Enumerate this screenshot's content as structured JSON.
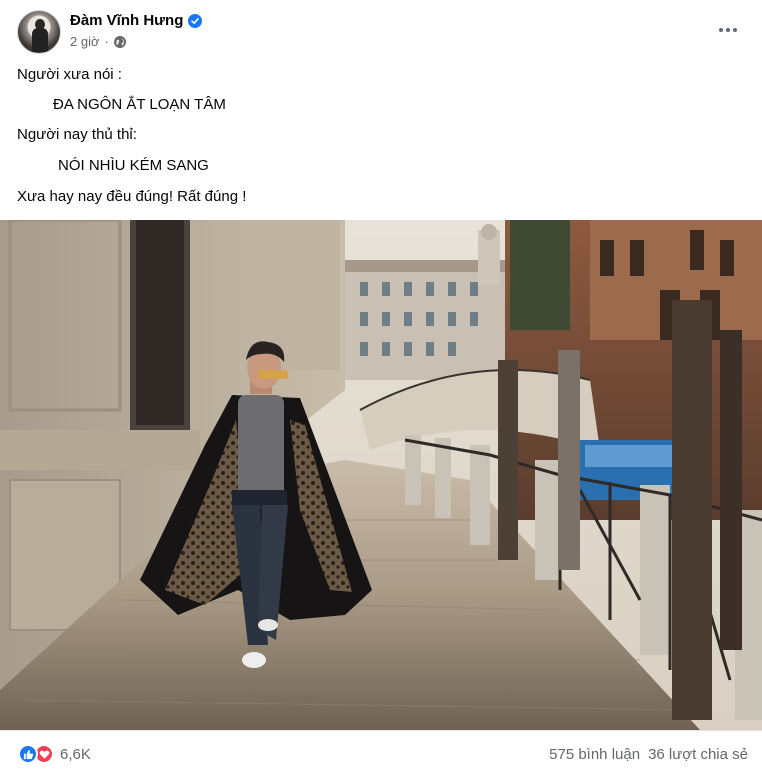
{
  "post": {
    "author": "Đàm Vĩnh Hưng",
    "verified": true,
    "time": "2 giờ",
    "privacy_icon": "globe-icon",
    "more_icon": "more-options-icon",
    "lines": [
      "Người xưa nói :",
      "ĐA NGÔN ẮT LOẠN TÂM",
      "Người nay thủ thỉ:",
      "NÓI NHÌU KÉM SANG",
      "Xưa hay nay đều đúng! Rất đúng !"
    ]
  },
  "photo": {
    "subject": "man-walking-venice-canal-photo"
  },
  "footer": {
    "reaction_icons": [
      "like-icon",
      "love-icon"
    ],
    "reaction_count": "6,6K",
    "comments": "575 bình luận",
    "shares": "36 lượt chia sẻ"
  },
  "colors": {
    "brand_blue": "#1877f2",
    "love_red": "#f33e58",
    "secondary_text": "#65676b"
  }
}
